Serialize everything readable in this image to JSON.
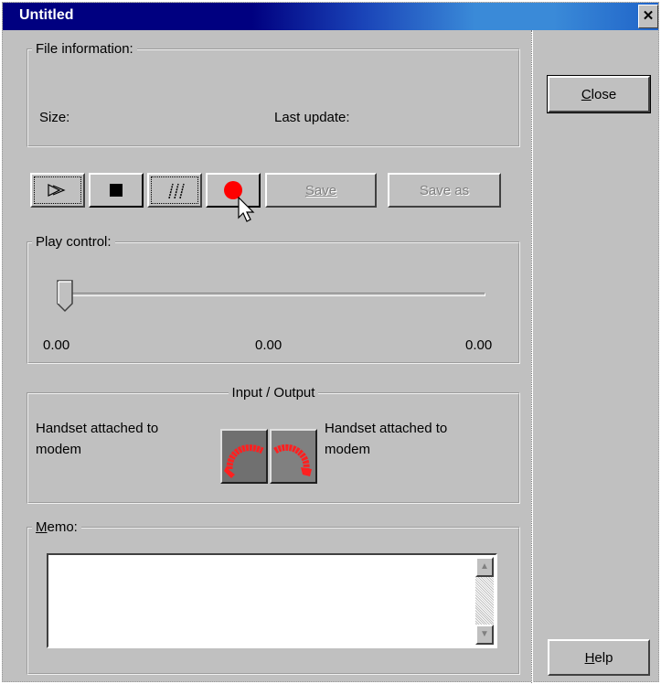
{
  "window": {
    "title": "Untitled",
    "close_glyph": "✕"
  },
  "file_info": {
    "legend": "File information:",
    "size_label": "Size:",
    "last_update_label": "Last update:"
  },
  "toolbar": {
    "play_icon": "play-icon",
    "stop_icon": "stop-icon",
    "pause_icon": "pause-icon",
    "record_icon": "record-icon",
    "record_color": "#ff0000",
    "save_label": "Save",
    "save_as_label": "Save as"
  },
  "play_control": {
    "legend": "Play control:",
    "position": 0.0,
    "labels": [
      "0.00",
      "0.00",
      "0.00"
    ]
  },
  "io": {
    "legend": "Input / Output",
    "left_line1": "Handset attached to",
    "left_line2": "modem",
    "right_line1": "Handset attached to",
    "right_line2": "modem",
    "handset_color": "#ff2020"
  },
  "memo": {
    "legend": "Memo:",
    "value": ""
  },
  "side": {
    "close_label": "Close",
    "help_label": "Help"
  }
}
